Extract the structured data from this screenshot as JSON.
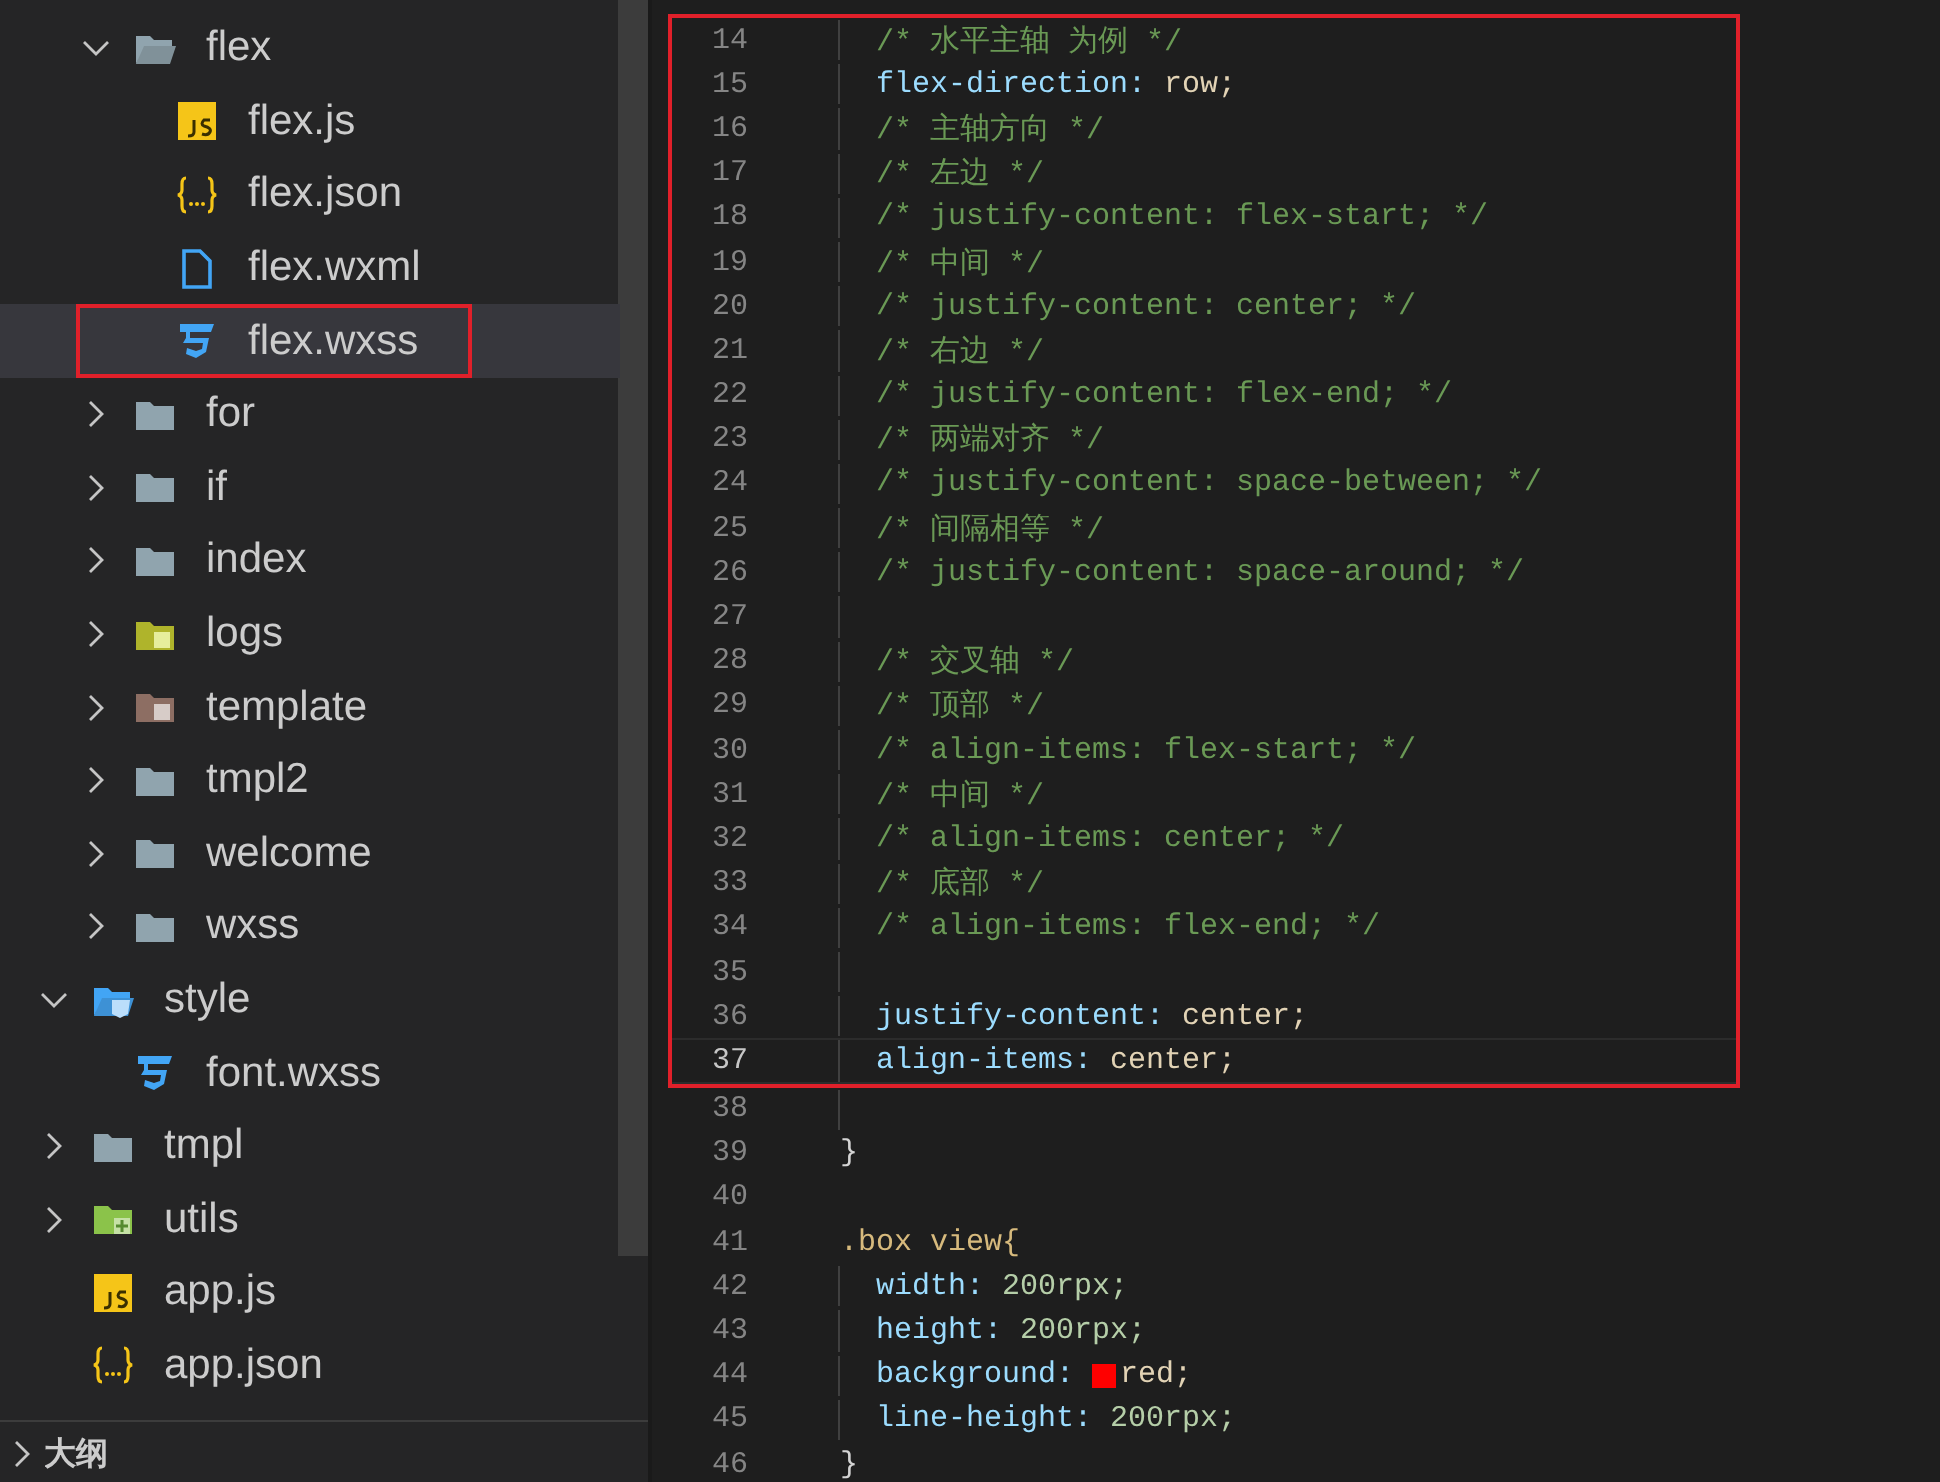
{
  "explorer": {
    "partial_children": [
      {
        "name": "flex",
        "kind": "folder",
        "expanded": true,
        "selected": false,
        "outlined": false,
        "children": [
          {
            "name": "flex.js",
            "kind": "js",
            "selected": false,
            "outlined": false
          },
          {
            "name": "flex.json",
            "kind": "json",
            "selected": false,
            "outlined": false
          },
          {
            "name": "flex.wxml",
            "kind": "wxml",
            "selected": false,
            "outlined": false
          },
          {
            "name": "flex.wxss",
            "kind": "wxss",
            "selected": true,
            "outlined": true
          }
        ]
      },
      {
        "name": "for",
        "kind": "folder",
        "expanded": false,
        "selected": false,
        "outlined": false
      },
      {
        "name": "if",
        "kind": "folder",
        "expanded": false,
        "selected": false,
        "outlined": false
      },
      {
        "name": "index",
        "kind": "folder",
        "expanded": false,
        "selected": false,
        "outlined": false
      },
      {
        "name": "logs",
        "kind": "folder-logs",
        "expanded": false,
        "selected": false,
        "outlined": false
      },
      {
        "name": "template",
        "kind": "folder-template",
        "expanded": false,
        "selected": false,
        "outlined": false
      },
      {
        "name": "tmpl2",
        "kind": "folder",
        "expanded": false,
        "selected": false,
        "outlined": false
      },
      {
        "name": "welcome",
        "kind": "folder",
        "expanded": false,
        "selected": false,
        "outlined": false
      },
      {
        "name": "wxss",
        "kind": "folder",
        "expanded": false,
        "selected": false,
        "outlined": false
      }
    ],
    "items": [
      {
        "name": "style",
        "kind": "folder-style",
        "expanded": true,
        "selected": false,
        "outlined": false,
        "children": [
          {
            "name": "font.wxss",
            "kind": "wxss",
            "selected": false,
            "outlined": false
          }
        ]
      },
      {
        "name": "tmpl",
        "kind": "folder",
        "expanded": false,
        "selected": false,
        "outlined": false
      },
      {
        "name": "utils",
        "kind": "folder-utils",
        "expanded": false,
        "selected": false,
        "outlined": false
      },
      {
        "name": "app.js",
        "kind": "js",
        "selected": false,
        "outlined": false
      },
      {
        "name": "app.json",
        "kind": "json",
        "selected": false,
        "outlined": false
      }
    ]
  },
  "outline_panel": {
    "title": "大纲",
    "expanded": false
  },
  "editor": {
    "blocks": [
      {
        "outlined": true,
        "lines": [
          {
            "number": "14",
            "kind": "comment",
            "indent": true,
            "text": "/* 水平主轴 为例 */",
            "current": false
          },
          {
            "number": "15",
            "kind": "decl",
            "indent": true,
            "property": "flex-direction:",
            "value": "row;",
            "current": false
          },
          {
            "number": "16",
            "kind": "comment",
            "indent": true,
            "text": "/* 主轴方向 */",
            "current": false
          },
          {
            "number": "17",
            "kind": "comment",
            "indent": true,
            "text": "/* 左边 */",
            "current": false
          },
          {
            "number": "18",
            "kind": "comment",
            "indent": true,
            "text": "/* justify-content: flex-start; */",
            "current": false
          },
          {
            "number": "19",
            "kind": "comment",
            "indent": true,
            "text": "/* 中间 */",
            "current": false
          },
          {
            "number": "20",
            "kind": "comment",
            "indent": true,
            "text": "/* justify-content: center; */",
            "current": false
          },
          {
            "number": "21",
            "kind": "comment",
            "indent": true,
            "text": "/* 右边 */",
            "current": false
          },
          {
            "number": "22",
            "kind": "comment",
            "indent": true,
            "text": "/* justify-content: flex-end; */",
            "current": false
          },
          {
            "number": "23",
            "kind": "comment",
            "indent": true,
            "text": "/* 两端对齐 */",
            "current": false
          },
          {
            "number": "24",
            "kind": "comment",
            "indent": true,
            "text": "/* justify-content: space-between; */",
            "current": false
          },
          {
            "number": "25",
            "kind": "comment",
            "indent": true,
            "text": "/* 间隔相等 */",
            "current": false
          },
          {
            "number": "26",
            "kind": "comment",
            "indent": true,
            "text": "/* justify-content: space-around; */",
            "current": false
          },
          {
            "number": "27",
            "kind": "blank",
            "indent": true,
            "current": false
          },
          {
            "number": "28",
            "kind": "comment",
            "indent": true,
            "text": "/* 交叉轴 */",
            "current": false
          },
          {
            "number": "29",
            "kind": "comment",
            "indent": true,
            "text": "/* 顶部 */",
            "current": false
          },
          {
            "number": "30",
            "kind": "comment",
            "indent": true,
            "text": "/* align-items: flex-start; */",
            "current": false
          },
          {
            "number": "31",
            "kind": "comment",
            "indent": true,
            "text": "/* 中间 */",
            "current": false
          },
          {
            "number": "32",
            "kind": "comment",
            "indent": true,
            "text": "/* align-items: center; */",
            "current": false
          },
          {
            "number": "33",
            "kind": "comment",
            "indent": true,
            "text": "/* 底部 */",
            "current": false
          },
          {
            "number": "34",
            "kind": "comment",
            "indent": true,
            "text": "/* align-items: flex-end; */",
            "current": false
          },
          {
            "number": "35",
            "kind": "blank",
            "indent": true,
            "current": false
          },
          {
            "number": "36",
            "kind": "decl",
            "indent": true,
            "property": "justify-content:",
            "value": "center;",
            "current": false
          },
          {
            "number": "37",
            "kind": "decl",
            "indent": true,
            "property": "align-items:",
            "value": "center;",
            "current": true
          }
        ]
      },
      {
        "outlined": false,
        "lines": [
          {
            "number": "38",
            "kind": "blank",
            "indent": true,
            "current": false
          },
          {
            "number": "39",
            "kind": "brace",
            "indent": false,
            "text": "}",
            "current": false
          },
          {
            "number": "40",
            "kind": "blank",
            "indent": false,
            "current": false
          },
          {
            "number": "41",
            "kind": "selector",
            "indent": false,
            "text": ".box view{",
            "current": false
          },
          {
            "number": "42",
            "kind": "decl-number",
            "indent": true,
            "property": "width:",
            "value": "200rpx;",
            "current": false
          },
          {
            "number": "43",
            "kind": "decl-number",
            "indent": true,
            "property": "height:",
            "value": "200rpx;",
            "current": false
          },
          {
            "number": "44",
            "kind": "decl",
            "indent": true,
            "property": "background:",
            "value": "red;",
            "color": "#ff0000",
            "current": false
          },
          {
            "number": "45",
            "kind": "decl-number",
            "indent": true,
            "property": "line-height:",
            "value": "200rpx;",
            "current": false
          },
          {
            "number": "46",
            "kind": "brace",
            "indent": false,
            "text": "}",
            "current": false
          }
        ]
      }
    ]
  }
}
